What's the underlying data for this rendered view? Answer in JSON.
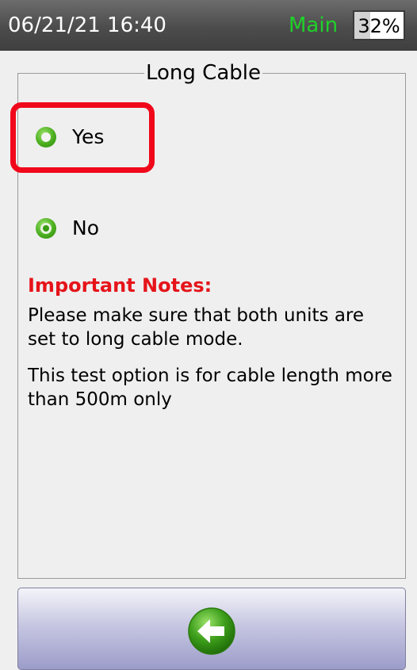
{
  "status_bar": {
    "datetime": "06/21/21 16:40",
    "screen_name": "Main",
    "battery_percent": 32,
    "battery_text": "32%",
    "screen_name_color": "#1fd12a"
  },
  "group": {
    "title": "Long Cable"
  },
  "options": [
    {
      "label": "Yes",
      "selected": false,
      "highlighted": true
    },
    {
      "label": "No",
      "selected": true,
      "highlighted": false
    }
  ],
  "notes": {
    "heading": "Important Notes:",
    "heading_color": "#e5141a",
    "paragraphs": [
      "Please make sure that both units are set to long cable mode.",
      "This test option is for cable length more than 500m only"
    ]
  },
  "footer": {
    "back_icon": "back-arrow-icon"
  },
  "colors": {
    "highlight": "#f0081a",
    "radio_green": "#4aad1e",
    "button_gradient_bottom": "#9c9cca"
  }
}
